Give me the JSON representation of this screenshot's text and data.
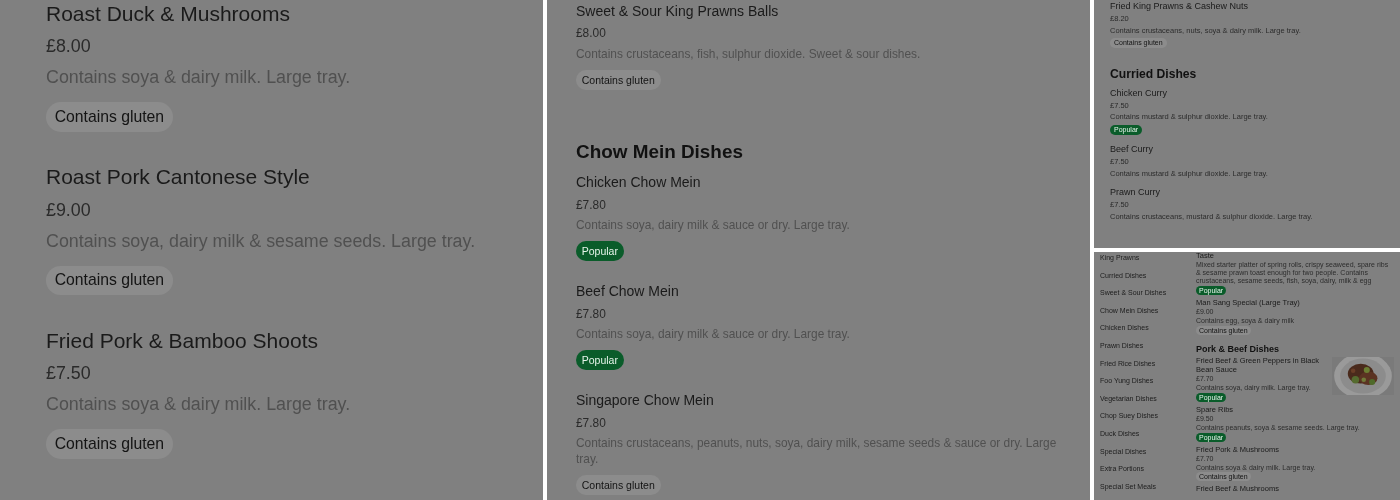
{
  "panels": [
    {
      "sections": [
        {
          "items": [
            {
              "name": "Roast Duck & Mushrooms",
              "price": "£8.00",
              "description": "Contains soya & dairy milk. Large tray.",
              "tags": [
                {
                  "label": "Contains gluten",
                  "kind": "gluten"
                }
              ]
            },
            {
              "name": "Roast Pork Cantonese Style",
              "price": "£9.00",
              "description": "Contains soya, dairy milk & sesame seeds. Large tray.",
              "tags": [
                {
                  "label": "Contains gluten",
                  "kind": "gluten"
                }
              ]
            },
            {
              "name": "Fried Pork & Bamboo Shoots",
              "price": "£7.50",
              "description": "Contains soya & dairy milk. Large tray.",
              "tags": [
                {
                  "label": "Contains gluten",
                  "kind": "gluten"
                }
              ]
            }
          ]
        }
      ]
    },
    {
      "sections": [
        {
          "items": [
            {
              "name": "Sweet & Sour King Prawns Balls",
              "price": "£8.00",
              "description": "Contains crustaceans, fish, sulphur dioxide. Sweet & sour dishes.",
              "tags": [
                {
                  "label": "Contains gluten",
                  "kind": "gluten"
                }
              ]
            }
          ]
        },
        {
          "heading": "Chow Mein Dishes",
          "items": [
            {
              "name": "Chicken Chow Mein",
              "price": "£7.80",
              "description": "Contains soya, dairy milk & sauce or dry. Large tray.",
              "tags": [
                {
                  "label": "Popular",
                  "kind": "popular"
                }
              ]
            },
            {
              "name": "Beef Chow Mein",
              "price": "£7.80",
              "description": "Contains soya, dairy milk & sauce or dry. Large tray.",
              "tags": [
                {
                  "label": "Popular",
                  "kind": "popular"
                }
              ]
            },
            {
              "name": "Singapore Chow Mein",
              "price": "£7.80",
              "description": "Contains crustaceans, peanuts, nuts, soya, dairy milk, sesame seeds & sauce or dry. Large tray.",
              "tags": [
                {
                  "label": "Contains gluten",
                  "kind": "gluten"
                }
              ]
            }
          ]
        }
      ]
    },
    {
      "sections": [
        {
          "items": [
            {
              "name": "Fried King Prawns & Cashew Nuts",
              "price": "£8.20",
              "description": "Contains crustaceans, nuts, soya & dairy milk. Large tray.",
              "tags": [
                {
                  "label": "Contains gluten",
                  "kind": "gluten"
                }
              ]
            }
          ]
        },
        {
          "heading": "Curried Dishes",
          "items": [
            {
              "name": "Chicken Curry",
              "price": "£7.50",
              "description": "Contains mustard & sulphur dioxide. Large tray.",
              "tags": [
                {
                  "label": "Popular",
                  "kind": "popular"
                }
              ]
            },
            {
              "name": "Beef Curry",
              "price": "£7.50",
              "description": "Contains mustard & sulphur dioxide. Large tray."
            },
            {
              "name": "Prawn Curry",
              "price": "£7.50",
              "description": "Contains crustaceans, mustard & sulphur dioxide. Large tray."
            }
          ]
        }
      ]
    },
    {
      "sidebar": [
        "King Prawns",
        "Curried Dishes",
        "Sweet & Sour Dishes",
        "Chow Mein Dishes",
        "Chicken Dishes",
        "Prawn Dishes",
        "Fried Rice Dishes",
        "Foo Yung Dishes",
        "Vegetarian Dishes",
        "Chop Suey Dishes",
        "Duck Dishes",
        "Special Dishes",
        "Extra Portions",
        "Special Set Meals"
      ],
      "sections": [
        {
          "items": [
            {
              "name": "Taste",
              "description": "Mixed starter platter of spring rolls, crispy seaweed, spare ribs & sesame prawn toast enough for two people. Contains crustaceans, sesame seeds, fish, soya, dairy, milk & egg",
              "tags": [
                {
                  "label": "Popular",
                  "kind": "popular"
                }
              ]
            },
            {
              "name": "Man Sang Special (Large Tray)",
              "price": "£9.00",
              "description": "Contains egg, soya & dairy milk",
              "tags": [
                {
                  "label": "Contains gluten",
                  "kind": "gluten"
                }
              ]
            }
          ]
        },
        {
          "heading": "Pork & Beef Dishes",
          "items": [
            {
              "name": "Fried Beef & Green Peppers in Black Bean Sauce",
              "price": "£7.70",
              "description": "Contains soya, dairy milk. Large tray.",
              "tags": [
                {
                  "label": "Popular",
                  "kind": "popular"
                }
              ],
              "picture": {
                "kind": "picture"
              }
            },
            {
              "name": "Spare Ribs",
              "price": "£9.50",
              "description": "Contains peanuts, soya & sesame seeds. Large tray.",
              "tags": [
                {
                  "label": "Popular",
                  "kind": "popular"
                }
              ]
            },
            {
              "name": "Fried Pork & Mushrooms",
              "price": "£7.70",
              "description": "Contains soya & dairy milk. Large tray.",
              "tags": [
                {
                  "label": "Contains gluten",
                  "kind": "gluten"
                }
              ]
            },
            {
              "name": "Fried Beef & Mushrooms"
            }
          ]
        }
      ]
    }
  ]
}
